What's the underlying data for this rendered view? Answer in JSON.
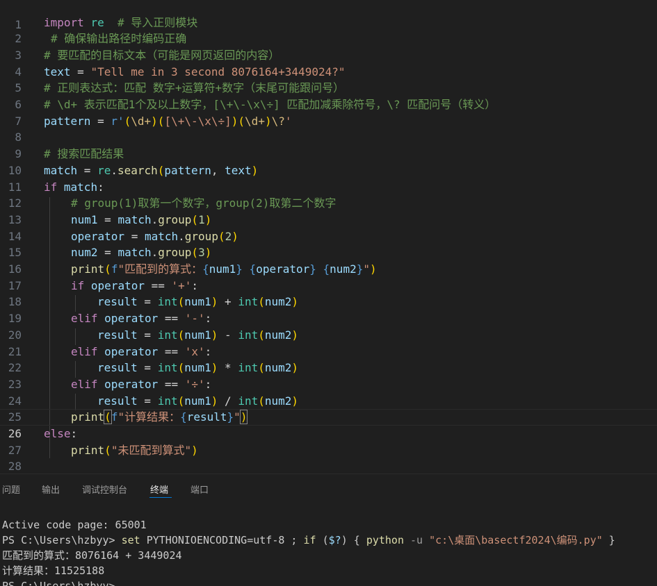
{
  "editor": {
    "line_numbers": [
      "1",
      "2",
      "3",
      "4",
      "5",
      "6",
      "7",
      "8",
      "9",
      "10",
      "11",
      "12",
      "13",
      "14",
      "15",
      "16",
      "17",
      "18",
      "19",
      "20",
      "21",
      "22",
      "23",
      "24",
      "25",
      "26",
      "27",
      "28"
    ],
    "current_line": "26",
    "l2": {
      "kw": "import",
      "mod": "re",
      "comment": "# 导入正则模块"
    },
    "l3": {
      "comment": "# 确保输出路径时编码正确"
    },
    "l4": {
      "comment": "# 要匹配的目标文本（可能是网页返回的内容）"
    },
    "l5": {
      "var": "text",
      "eq": " = ",
      "str": "\"Tell me in 3 second 8076164+3449024?\""
    },
    "l6": {
      "comment": "# 正则表达式：匹配 数字+运算符+数字（末尾可能跟问号）"
    },
    "l7": {
      "comment": "# \\d+ 表示匹配1个及以上数字，[\\+\\-\\x\\÷] 匹配加减乘除符号，\\? 匹配问号（转义）"
    },
    "l8": {
      "var": "pattern",
      "eq": " = ",
      "prefix": "r'",
      "g1o": "(",
      "d1": "\\d+",
      "g1c": ")",
      "g2o": "(",
      "cls": "[\\+\\-\\x\\÷]",
      "g2c": ")",
      "g3o": "(",
      "d2": "\\d+",
      "g3c": ")",
      "q": "\\?",
      "end": "'"
    },
    "l10": {
      "comment": "# 搜索匹配结果"
    },
    "l11": {
      "var": "match",
      "eq": " = ",
      "mod": "re",
      "dot": ".",
      "fn": "search",
      "po": "(",
      "a1": "pattern",
      "sep": ", ",
      "a2": "text",
      "pc": ")"
    },
    "l12": {
      "kw": "if",
      "var": "match",
      "colon": ":"
    },
    "l13": {
      "comment": "# group(1)取第一个数字，group(2)取第二个数字"
    },
    "l14": {
      "var": "num1",
      "eq": " = ",
      "obj": "match",
      "fn": "group",
      "arg": "1"
    },
    "l15": {
      "var": "operator",
      "eq": " = ",
      "obj": "match",
      "fn": "group",
      "arg": "2"
    },
    "l16": {
      "var": "num2",
      "eq": " = ",
      "obj": "match",
      "fn": "group",
      "arg": "3"
    },
    "l17": {
      "fn": "print",
      "f": "f",
      "s1": "\"匹配到的算式：",
      "v1": "num1",
      "v2": "operator",
      "v3": "num2",
      "s2": "\""
    },
    "l18": {
      "kw": "if",
      "var": "operator",
      "op": " == ",
      "str": "'+'",
      "colon": ":"
    },
    "l19": {
      "var": "result",
      "eq": " = ",
      "bi": "int",
      "a": "num1",
      "op": " + ",
      "b": "num2"
    },
    "l20": {
      "kw": "elif",
      "var": "operator",
      "op": " == ",
      "str": "'-'",
      "colon": ":"
    },
    "l21": {
      "var": "result",
      "eq": " = ",
      "bi": "int",
      "a": "num1",
      "op": " - ",
      "b": "num2"
    },
    "l22": {
      "kw": "elif",
      "var": "operator",
      "op": " == ",
      "str": "'x'",
      "colon": ":"
    },
    "l23": {
      "var": "result",
      "eq": " = ",
      "bi": "int",
      "a": "num1",
      "op": " * ",
      "b": "num2"
    },
    "l24": {
      "kw": "elif",
      "var": "operator",
      "op": " == ",
      "str": "'÷'",
      "colon": ":"
    },
    "l25": {
      "var": "result",
      "eq": " = ",
      "bi": "int",
      "a": "num1",
      "op": " / ",
      "b": "num2"
    },
    "l26": {
      "fn": "print",
      "f": "f",
      "s1": "\"计算结果：",
      "v1": "result",
      "s2": "\""
    },
    "l27": {
      "kw": "else",
      "colon": ":"
    },
    "l28": {
      "fn": "print",
      "str": "\"未匹配到算式\""
    }
  },
  "panel": {
    "tabs": [
      "问题",
      "输出",
      "调试控制台",
      "终端",
      "端口"
    ],
    "active_tab": "终端"
  },
  "terminal": {
    "line1": "Active code page: 65001",
    "prompt": "PS C:\\Users\\hzbyy> ",
    "cmd_set": "set",
    "cmd_set_arg": " PYTHONIOENCODING=utf-8 ; ",
    "cmd_if": "if",
    "cmd_cond_open": " (",
    "cmd_cond_var": "$?",
    "cmd_cond_close": ") { ",
    "cmd_python": "python",
    "cmd_param": " -u ",
    "cmd_path": "\"c:\\桌面\\basectf2024\\编码.py\"",
    "cmd_end": " }",
    "out1": "匹配到的算式：8076164 + 3449024",
    "out2": "计算结果：11525188",
    "prompt2": "PS C:\\Users\\hzbyy>"
  },
  "colors": {
    "background": "#1f1f1f",
    "keyword": "#c586c0",
    "string": "#ce9178",
    "comment": "#6a9955",
    "variable": "#9cdcfe",
    "function": "#dcdcaa",
    "number": "#b5cea8",
    "accent": "#0078d4"
  }
}
